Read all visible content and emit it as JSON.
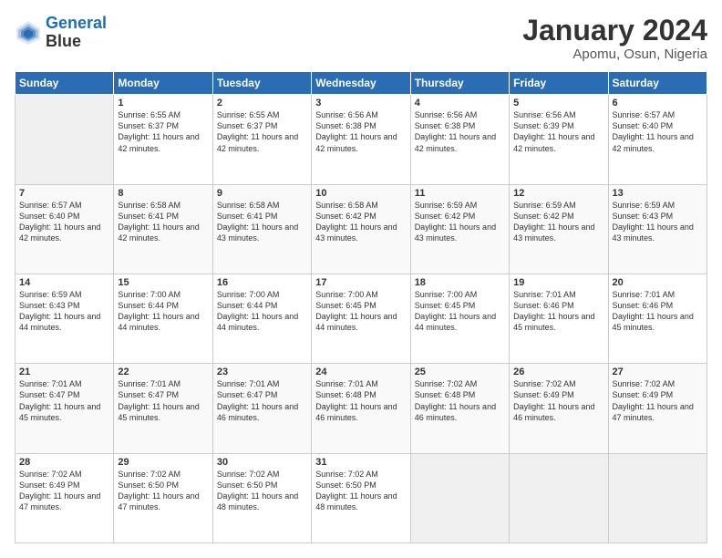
{
  "header": {
    "logo_line1": "General",
    "logo_line2": "Blue",
    "month": "January 2024",
    "location": "Apomu, Osun, Nigeria"
  },
  "days_of_week": [
    "Sunday",
    "Monday",
    "Tuesday",
    "Wednesday",
    "Thursday",
    "Friday",
    "Saturday"
  ],
  "weeks": [
    [
      {
        "day": "",
        "sunrise": "",
        "sunset": "",
        "daylight": ""
      },
      {
        "day": "1",
        "sunrise": "Sunrise: 6:55 AM",
        "sunset": "Sunset: 6:37 PM",
        "daylight": "Daylight: 11 hours and 42 minutes."
      },
      {
        "day": "2",
        "sunrise": "Sunrise: 6:55 AM",
        "sunset": "Sunset: 6:37 PM",
        "daylight": "Daylight: 11 hours and 42 minutes."
      },
      {
        "day": "3",
        "sunrise": "Sunrise: 6:56 AM",
        "sunset": "Sunset: 6:38 PM",
        "daylight": "Daylight: 11 hours and 42 minutes."
      },
      {
        "day": "4",
        "sunrise": "Sunrise: 6:56 AM",
        "sunset": "Sunset: 6:38 PM",
        "daylight": "Daylight: 11 hours and 42 minutes."
      },
      {
        "day": "5",
        "sunrise": "Sunrise: 6:56 AM",
        "sunset": "Sunset: 6:39 PM",
        "daylight": "Daylight: 11 hours and 42 minutes."
      },
      {
        "day": "6",
        "sunrise": "Sunrise: 6:57 AM",
        "sunset": "Sunset: 6:40 PM",
        "daylight": "Daylight: 11 hours and 42 minutes."
      }
    ],
    [
      {
        "day": "7",
        "sunrise": "Sunrise: 6:57 AM",
        "sunset": "Sunset: 6:40 PM",
        "daylight": "Daylight: 11 hours and 42 minutes."
      },
      {
        "day": "8",
        "sunrise": "Sunrise: 6:58 AM",
        "sunset": "Sunset: 6:41 PM",
        "daylight": "Daylight: 11 hours and 42 minutes."
      },
      {
        "day": "9",
        "sunrise": "Sunrise: 6:58 AM",
        "sunset": "Sunset: 6:41 PM",
        "daylight": "Daylight: 11 hours and 43 minutes."
      },
      {
        "day": "10",
        "sunrise": "Sunrise: 6:58 AM",
        "sunset": "Sunset: 6:42 PM",
        "daylight": "Daylight: 11 hours and 43 minutes."
      },
      {
        "day": "11",
        "sunrise": "Sunrise: 6:59 AM",
        "sunset": "Sunset: 6:42 PM",
        "daylight": "Daylight: 11 hours and 43 minutes."
      },
      {
        "day": "12",
        "sunrise": "Sunrise: 6:59 AM",
        "sunset": "Sunset: 6:42 PM",
        "daylight": "Daylight: 11 hours and 43 minutes."
      },
      {
        "day": "13",
        "sunrise": "Sunrise: 6:59 AM",
        "sunset": "Sunset: 6:43 PM",
        "daylight": "Daylight: 11 hours and 43 minutes."
      }
    ],
    [
      {
        "day": "14",
        "sunrise": "Sunrise: 6:59 AM",
        "sunset": "Sunset: 6:43 PM",
        "daylight": "Daylight: 11 hours and 44 minutes."
      },
      {
        "day": "15",
        "sunrise": "Sunrise: 7:00 AM",
        "sunset": "Sunset: 6:44 PM",
        "daylight": "Daylight: 11 hours and 44 minutes."
      },
      {
        "day": "16",
        "sunrise": "Sunrise: 7:00 AM",
        "sunset": "Sunset: 6:44 PM",
        "daylight": "Daylight: 11 hours and 44 minutes."
      },
      {
        "day": "17",
        "sunrise": "Sunrise: 7:00 AM",
        "sunset": "Sunset: 6:45 PM",
        "daylight": "Daylight: 11 hours and 44 minutes."
      },
      {
        "day": "18",
        "sunrise": "Sunrise: 7:00 AM",
        "sunset": "Sunset: 6:45 PM",
        "daylight": "Daylight: 11 hours and 44 minutes."
      },
      {
        "day": "19",
        "sunrise": "Sunrise: 7:01 AM",
        "sunset": "Sunset: 6:46 PM",
        "daylight": "Daylight: 11 hours and 45 minutes."
      },
      {
        "day": "20",
        "sunrise": "Sunrise: 7:01 AM",
        "sunset": "Sunset: 6:46 PM",
        "daylight": "Daylight: 11 hours and 45 minutes."
      }
    ],
    [
      {
        "day": "21",
        "sunrise": "Sunrise: 7:01 AM",
        "sunset": "Sunset: 6:47 PM",
        "daylight": "Daylight: 11 hours and 45 minutes."
      },
      {
        "day": "22",
        "sunrise": "Sunrise: 7:01 AM",
        "sunset": "Sunset: 6:47 PM",
        "daylight": "Daylight: 11 hours and 45 minutes."
      },
      {
        "day": "23",
        "sunrise": "Sunrise: 7:01 AM",
        "sunset": "Sunset: 6:47 PM",
        "daylight": "Daylight: 11 hours and 46 minutes."
      },
      {
        "day": "24",
        "sunrise": "Sunrise: 7:01 AM",
        "sunset": "Sunset: 6:48 PM",
        "daylight": "Daylight: 11 hours and 46 minutes."
      },
      {
        "day": "25",
        "sunrise": "Sunrise: 7:02 AM",
        "sunset": "Sunset: 6:48 PM",
        "daylight": "Daylight: 11 hours and 46 minutes."
      },
      {
        "day": "26",
        "sunrise": "Sunrise: 7:02 AM",
        "sunset": "Sunset: 6:49 PM",
        "daylight": "Daylight: 11 hours and 46 minutes."
      },
      {
        "day": "27",
        "sunrise": "Sunrise: 7:02 AM",
        "sunset": "Sunset: 6:49 PM",
        "daylight": "Daylight: 11 hours and 47 minutes."
      }
    ],
    [
      {
        "day": "28",
        "sunrise": "Sunrise: 7:02 AM",
        "sunset": "Sunset: 6:49 PM",
        "daylight": "Daylight: 11 hours and 47 minutes."
      },
      {
        "day": "29",
        "sunrise": "Sunrise: 7:02 AM",
        "sunset": "Sunset: 6:50 PM",
        "daylight": "Daylight: 11 hours and 47 minutes."
      },
      {
        "day": "30",
        "sunrise": "Sunrise: 7:02 AM",
        "sunset": "Sunset: 6:50 PM",
        "daylight": "Daylight: 11 hours and 48 minutes."
      },
      {
        "day": "31",
        "sunrise": "Sunrise: 7:02 AM",
        "sunset": "Sunset: 6:50 PM",
        "daylight": "Daylight: 11 hours and 48 minutes."
      },
      {
        "day": "",
        "sunrise": "",
        "sunset": "",
        "daylight": ""
      },
      {
        "day": "",
        "sunrise": "",
        "sunset": "",
        "daylight": ""
      },
      {
        "day": "",
        "sunrise": "",
        "sunset": "",
        "daylight": ""
      }
    ]
  ]
}
